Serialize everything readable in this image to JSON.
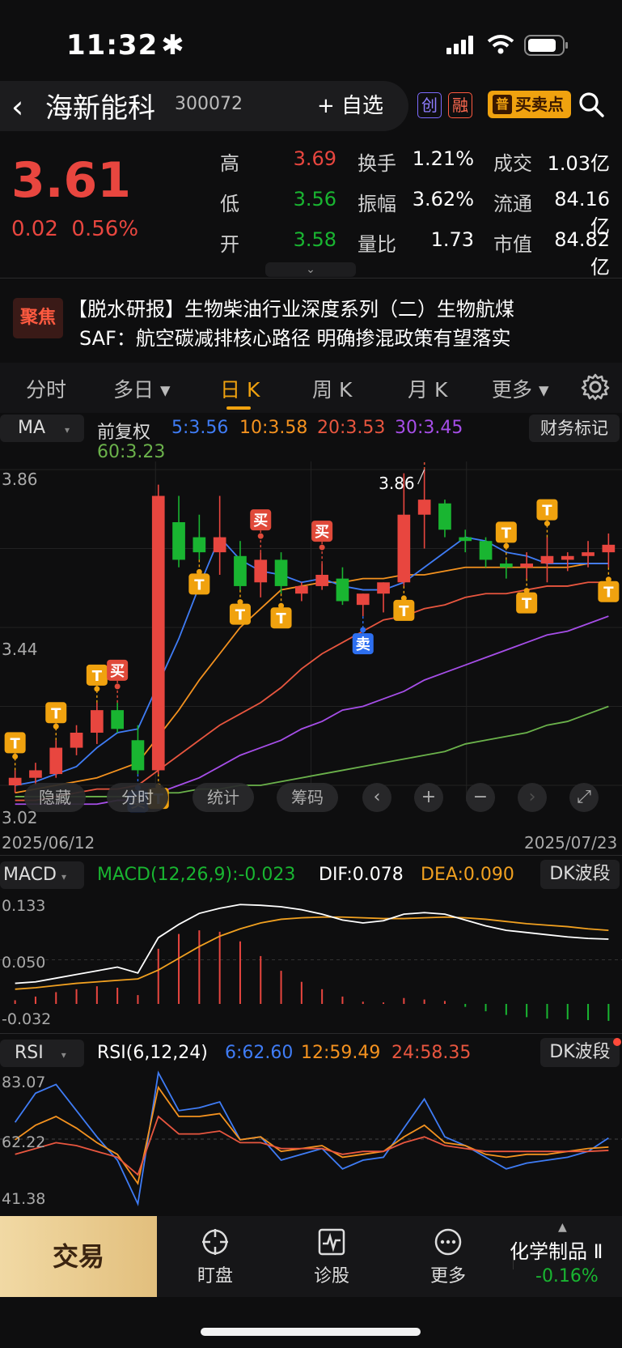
{
  "status_bar": {
    "time": "11:32",
    "time_suffix": "✱"
  },
  "header": {
    "back_symbol": "‹",
    "stock_name": "海新能科",
    "stock_code": "300072",
    "watch_label": "+ 自选",
    "tag_chuang": "创",
    "tag_rong": "融",
    "buypoint_prefix": "普",
    "buypoint_label": "买卖点"
  },
  "quote": {
    "price": "3.61",
    "change": "0.02",
    "change_pct": "0.56%",
    "rows": [
      {
        "l1": "高",
        "v1": "3.69",
        "l2": "换手",
        "v2": "1.21%",
        "l3": "成交",
        "v3": "1.03亿"
      },
      {
        "l1": "低",
        "v1": "3.56",
        "l2": "振幅",
        "v2": "3.62%",
        "l3": "流通",
        "v3": "84.16亿"
      },
      {
        "l1": "开",
        "v1": "3.58",
        "l2": "量比",
        "v2": "1.73",
        "l3": "市值",
        "v3": "84.82亿"
      }
    ],
    "v1_colors": [
      "#e8463f",
      "#19b531",
      "#19b531"
    ],
    "expand_icon": "⌄"
  },
  "news": {
    "badge": "聚焦",
    "line1": "【脱水研报】生物柴油行业深度系列（二）生物航煤",
    "line2": "SAF：航空碳减排核心路径 明确掺混政策有望落实"
  },
  "tabs": [
    {
      "label": "分时"
    },
    {
      "label": "多日 ▾"
    },
    {
      "label": "日 K"
    },
    {
      "label": "周 K"
    },
    {
      "label": "月 K"
    },
    {
      "label": "更多 ▾"
    }
  ],
  "ma_row": {
    "selector": "MA",
    "mode": "前复权",
    "ma5": "5:3.56",
    "ma10": "10:3.58",
    "ma20": "20:3.53",
    "ma30": "30:3.45",
    "ma60": "60:3.23",
    "finance_btn": "财务标记"
  },
  "price_axis": {
    "top": "3.86",
    "mid": "3.44",
    "bottom": "3.02",
    "high_label": "3.86"
  },
  "date_axis": {
    "start": "2025/06/12",
    "end": "2025/07/23"
  },
  "chart_controls": {
    "hide": "隐藏",
    "intraday": "分时",
    "stats": "统计",
    "chips": "筹码"
  },
  "macd": {
    "selector": "MACD",
    "value": "MACD(12,26,9):-0.023",
    "dif": "DIF:0.078",
    "dea": "DEA:0.090",
    "btn": "DK波段",
    "axis_top": "0.133",
    "axis_mid": "0.050",
    "axis_bottom": "-0.032"
  },
  "rsi": {
    "selector": "RSI",
    "value": "RSI(6,12,24)",
    "r6": "6:62.60",
    "r12": "12:59.49",
    "r24": "24:58.35",
    "btn": "DK波段",
    "axis_top": "83.07",
    "axis_mid": "62.22",
    "axis_bottom": "41.38"
  },
  "bottom_nav": {
    "trade": "交易",
    "watch": "盯盘",
    "diagnose": "诊股",
    "more": "更多",
    "sector_name": "化学制品 Ⅱ",
    "sector_change": "-0.16%"
  },
  "colors": {
    "up": "#e8463f",
    "down": "#19b531",
    "ma5": "#3f7cf5",
    "ma10": "#f4921f",
    "ma20": "#e8563f",
    "ma30": "#a64ee8",
    "ma60": "#6bb24b",
    "dea": "#f0a020"
  },
  "chart_data": [
    {
      "type": "candlestick",
      "x_range": [
        "2025/06/12",
        "2025/07/23"
      ],
      "ylim": [
        3.02,
        3.86
      ],
      "candles": [
        {
          "o": 3.02,
          "h": 3.06,
          "l": 3.0,
          "c": 3.04
        },
        {
          "o": 3.04,
          "h": 3.08,
          "l": 3.02,
          "c": 3.06
        },
        {
          "o": 3.05,
          "h": 3.14,
          "l": 3.04,
          "c": 3.12
        },
        {
          "o": 3.12,
          "h": 3.18,
          "l": 3.1,
          "c": 3.16
        },
        {
          "o": 3.16,
          "h": 3.24,
          "l": 3.13,
          "c": 3.22
        },
        {
          "o": 3.22,
          "h": 3.24,
          "l": 3.16,
          "c": 3.17
        },
        {
          "o": 3.14,
          "h": 3.18,
          "l": 3.05,
          "c": 3.06
        },
        {
          "o": 3.06,
          "h": 3.82,
          "l": 3.05,
          "c": 3.79
        },
        {
          "o": 3.72,
          "h": 3.79,
          "l": 3.6,
          "c": 3.62
        },
        {
          "o": 3.68,
          "h": 3.74,
          "l": 3.62,
          "c": 3.64
        },
        {
          "o": 3.64,
          "h": 3.79,
          "l": 3.58,
          "c": 3.68
        },
        {
          "o": 3.63,
          "h": 3.67,
          "l": 3.54,
          "c": 3.55
        },
        {
          "o": 3.56,
          "h": 3.64,
          "l": 3.52,
          "c": 3.62
        },
        {
          "o": 3.62,
          "h": 3.64,
          "l": 3.53,
          "c": 3.55
        },
        {
          "o": 3.53,
          "h": 3.56,
          "l": 3.51,
          "c": 3.55
        },
        {
          "o": 3.55,
          "h": 3.61,
          "l": 3.54,
          "c": 3.58
        },
        {
          "o": 3.57,
          "h": 3.6,
          "l": 3.5,
          "c": 3.51
        },
        {
          "o": 3.5,
          "h": 3.53,
          "l": 3.47,
          "c": 3.53
        },
        {
          "o": 3.53,
          "h": 3.56,
          "l": 3.48,
          "c": 3.56
        },
        {
          "o": 3.56,
          "h": 3.85,
          "l": 3.55,
          "c": 3.74
        },
        {
          "o": 3.74,
          "h": 3.86,
          "l": 3.65,
          "c": 3.78
        },
        {
          "o": 3.77,
          "h": 3.78,
          "l": 3.68,
          "c": 3.7
        },
        {
          "o": 3.68,
          "h": 3.7,
          "l": 3.64,
          "c": 3.67
        },
        {
          "o": 3.67,
          "h": 3.68,
          "l": 3.6,
          "c": 3.62
        },
        {
          "o": 3.61,
          "h": 3.62,
          "l": 3.57,
          "c": 3.6
        },
        {
          "o": 3.6,
          "h": 3.64,
          "l": 3.57,
          "c": 3.61
        },
        {
          "o": 3.61,
          "h": 3.68,
          "l": 3.56,
          "c": 3.63
        },
        {
          "o": 3.62,
          "h": 3.64,
          "l": 3.59,
          "c": 3.63
        },
        {
          "o": 3.63,
          "h": 3.67,
          "l": 3.6,
          "c": 3.64
        },
        {
          "o": 3.64,
          "h": 3.69,
          "l": 3.6,
          "c": 3.66
        }
      ],
      "ma5": [
        3.02,
        3.03,
        3.05,
        3.07,
        3.12,
        3.16,
        3.17,
        3.29,
        3.41,
        3.55,
        3.68,
        3.62,
        3.59,
        3.58,
        3.56,
        3.57,
        3.55,
        3.54,
        3.54,
        3.56,
        3.6,
        3.64,
        3.68,
        3.67,
        3.64,
        3.63,
        3.61,
        3.61,
        3.61,
        3.61
      ],
      "ma10": [
        3.0,
        3.01,
        3.02,
        3.03,
        3.04,
        3.06,
        3.08,
        3.15,
        3.22,
        3.3,
        3.37,
        3.44,
        3.49,
        3.54,
        3.55,
        3.56,
        3.56,
        3.57,
        3.57,
        3.58,
        3.58,
        3.59,
        3.6,
        3.6,
        3.6,
        3.6,
        3.6,
        3.6,
        3.61,
        3.61
      ],
      "ma20": [
        2.98,
        2.98,
        2.99,
        3.0,
        3.01,
        3.01,
        3.02,
        3.06,
        3.1,
        3.14,
        3.18,
        3.21,
        3.24,
        3.28,
        3.33,
        3.37,
        3.4,
        3.43,
        3.46,
        3.47,
        3.49,
        3.5,
        3.52,
        3.53,
        3.53,
        3.54,
        3.55,
        3.55,
        3.56,
        3.56
      ],
      "ma30": [
        2.97,
        2.97,
        2.97,
        2.97,
        2.97,
        2.98,
        2.98,
        3.0,
        3.02,
        3.04,
        3.07,
        3.1,
        3.12,
        3.14,
        3.17,
        3.19,
        3.22,
        3.23,
        3.25,
        3.27,
        3.3,
        3.32,
        3.34,
        3.36,
        3.38,
        3.4,
        3.42,
        3.43,
        3.45,
        3.47
      ],
      "ma60": [
        2.99,
        2.99,
        2.99,
        2.99,
        2.99,
        2.99,
        2.99,
        3.0,
        3.0,
        3.01,
        3.01,
        3.02,
        3.02,
        3.03,
        3.04,
        3.05,
        3.06,
        3.07,
        3.08,
        3.09,
        3.1,
        3.11,
        3.13,
        3.14,
        3.15,
        3.16,
        3.18,
        3.19,
        3.21,
        3.23
      ],
      "signals": [
        {
          "i": 0,
          "label": "T",
          "kind": "T"
        },
        {
          "i": 2,
          "label": "T",
          "kind": "T"
        },
        {
          "i": 4,
          "label": "T",
          "kind": "T"
        },
        {
          "i": 5,
          "label": "买",
          "kind": "buy"
        },
        {
          "i": 6,
          "label": "卖",
          "kind": "sell"
        },
        {
          "i": 7,
          "label": "T",
          "kind": "T"
        },
        {
          "i": 9,
          "label": "T",
          "kind": "T"
        },
        {
          "i": 11,
          "label": "T",
          "kind": "T"
        },
        {
          "i": 12,
          "label": "买",
          "kind": "buy"
        },
        {
          "i": 13,
          "label": "T",
          "kind": "T"
        },
        {
          "i": 15,
          "label": "买",
          "kind": "buy"
        },
        {
          "i": 17,
          "label": "卖",
          "kind": "sell"
        },
        {
          "i": 19,
          "label": "T",
          "kind": "T"
        },
        {
          "i": 20,
          "label": "T",
          "kind": "T"
        },
        {
          "i": 20,
          "label": "买",
          "kind": "buy"
        },
        {
          "i": 24,
          "label": "T",
          "kind": "T"
        },
        {
          "i": 25,
          "label": "T",
          "kind": "T"
        },
        {
          "i": 26,
          "label": "T",
          "kind": "T"
        },
        {
          "i": 29,
          "label": "T",
          "kind": "T"
        }
      ]
    },
    {
      "type": "macd",
      "ylim": [
        -0.032,
        0.133
      ],
      "hist": [
        0.005,
        0.01,
        0.016,
        0.02,
        0.024,
        0.022,
        0.012,
        0.075,
        0.095,
        0.1,
        0.098,
        0.085,
        0.065,
        0.045,
        0.03,
        0.02,
        0.01,
        0.003,
        0.002,
        0.008,
        0.006,
        0.004,
        -0.004,
        -0.01,
        -0.015,
        -0.018,
        -0.02,
        -0.021,
        -0.022,
        -0.023
      ],
      "dif": [
        0.018,
        0.02,
        0.025,
        0.03,
        0.035,
        0.04,
        0.032,
        0.08,
        0.098,
        0.113,
        0.12,
        0.125,
        0.124,
        0.122,
        0.118,
        0.112,
        0.104,
        0.1,
        0.103,
        0.112,
        0.114,
        0.112,
        0.104,
        0.096,
        0.09,
        0.087,
        0.084,
        0.081,
        0.079,
        0.078
      ],
      "dea": [
        0.01,
        0.012,
        0.015,
        0.018,
        0.02,
        0.022,
        0.024,
        0.036,
        0.052,
        0.068,
        0.082,
        0.092,
        0.1,
        0.105,
        0.107,
        0.108,
        0.108,
        0.107,
        0.106,
        0.106,
        0.107,
        0.108,
        0.107,
        0.105,
        0.102,
        0.099,
        0.097,
        0.095,
        0.092,
        0.09
      ]
    },
    {
      "type": "line",
      "title": "RSI(6,12,24)",
      "ylim": [
        41.38,
        83.07
      ],
      "series": [
        {
          "name": "6",
          "values": [
            68,
            78,
            81,
            72,
            63,
            55,
            40,
            85,
            72,
            73,
            75,
            62,
            63,
            55,
            57,
            59,
            52,
            55,
            56,
            66,
            76,
            63,
            60,
            56,
            52,
            54,
            55,
            56,
            58,
            62.6
          ]
        },
        {
          "name": "12",
          "values": [
            62,
            67,
            70,
            66,
            61,
            57,
            47,
            80,
            70,
            70,
            71,
            62,
            63,
            58,
            59,
            60,
            56,
            57,
            58,
            63,
            67,
            61,
            60,
            57,
            56,
            57,
            57,
            58,
            59,
            59.5
          ]
        },
        {
          "name": "24",
          "values": [
            57,
            59,
            61,
            60,
            58,
            56,
            50,
            70,
            64,
            64,
            65,
            61,
            61,
            59,
            59,
            59,
            57,
            58,
            58,
            61,
            63,
            60,
            59,
            58,
            58,
            58,
            58,
            58,
            58,
            58.35
          ]
        }
      ]
    }
  ]
}
